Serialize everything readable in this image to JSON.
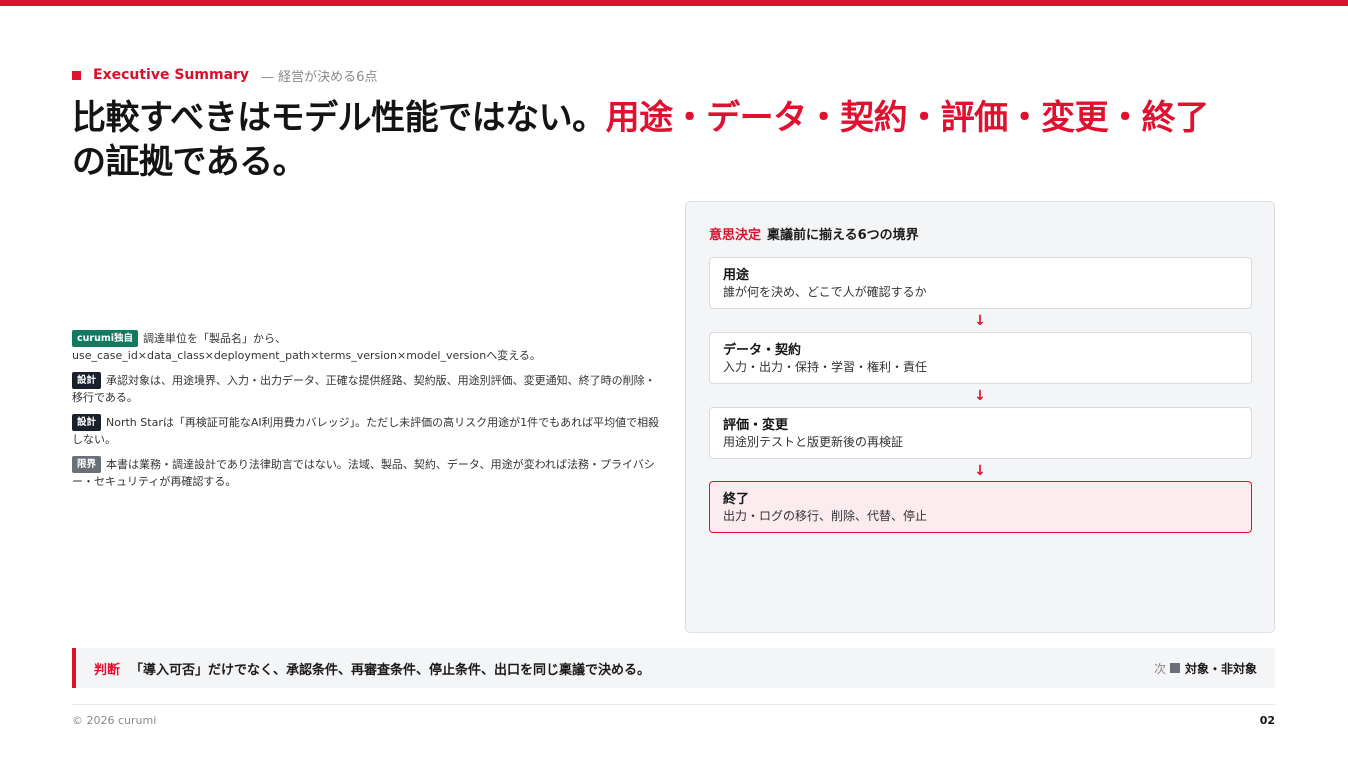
{
  "eyebrow": {
    "label": "Executive Summary",
    "sub": "— 経営が決める6点"
  },
  "headline": {
    "lead": "比較すべきはモデル性能ではない。",
    "accent": "用途・データ・契約・評価・変更・終了",
    "tail": "の証拠である。"
  },
  "notes": [
    {
      "badge": "curumi独自",
      "badge_color": "#127a5f",
      "text": "調達単位を「製品名」から、use_case_id×data_class×deployment_path×terms_version×model_versionへ変える。"
    },
    {
      "badge": "設計",
      "badge_color": "#1a1f2c",
      "text": "承認対象は、用途境界、入力・出力データ、正確な提供経路、契約版、用途別評価、変更通知、終了時の削除・移行である。"
    },
    {
      "badge": "設計",
      "badge_color": "#1a1f2c",
      "text": "North Starは「再検証可能なAI利用費カバレッジ」。ただし未評価の高リスク用途が1件でもあれば平均値で相殺しない。"
    },
    {
      "badge": "限界",
      "badge_color": "#6b6f78",
      "text": "本書は業務・調達設計であり法律助言ではない。法域、製品、契約、データ、用途が変われば法務・プライバシー・セキュリティが再確認する。"
    }
  ],
  "panel": {
    "tag": "意思決定",
    "title": "稟議前に揃える6つの境界",
    "arrow_glyph": "↓",
    "steps": [
      {
        "title": "用途",
        "desc": "誰が何を決め、どこで人が確認するか"
      },
      {
        "title": "データ・契約",
        "desc": "入力・出力・保持・学習・権利・責任"
      },
      {
        "title": "評価・変更",
        "desc": "用途別テストと版更新後の再検証"
      },
      {
        "title": "終了",
        "desc": "出力・ログの移行、削除、代替、停止"
      }
    ]
  },
  "decision": {
    "key": "判断",
    "text": "「導入可否」だけでなく、承認条件、再審査条件、停止条件、出口を同じ稟議で決める。",
    "next_label": "次",
    "next_title": "対象・非対象"
  },
  "footer": {
    "copyright": "© 2026 curumi",
    "page": "02"
  },
  "colors": {
    "accent": "#e0102f",
    "green": "#127a5f",
    "dark": "#1a1f2c",
    "gray": "#6b6f78"
  }
}
